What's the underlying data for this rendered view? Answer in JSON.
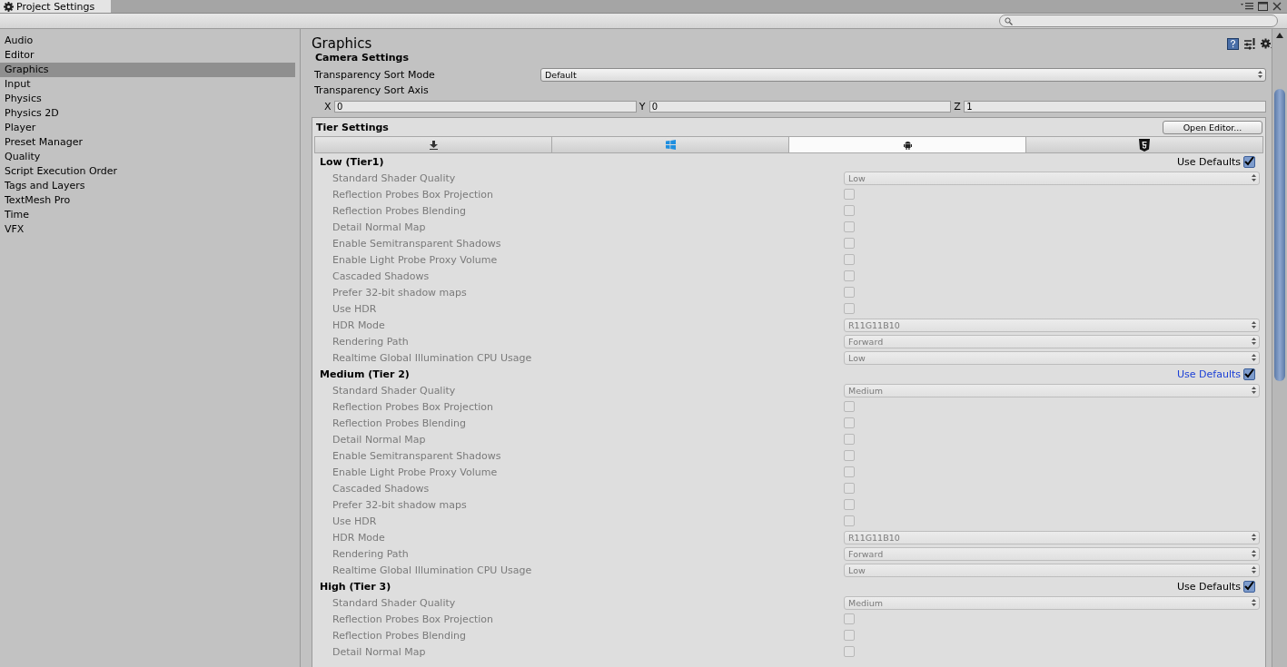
{
  "window": {
    "tab": "Project Settings"
  },
  "sidebar": {
    "items": [
      {
        "label": "Audio",
        "selected": false
      },
      {
        "label": "Editor",
        "selected": false
      },
      {
        "label": "Graphics",
        "selected": true
      },
      {
        "label": "Input",
        "selected": false
      },
      {
        "label": "Physics",
        "selected": false
      },
      {
        "label": "Physics 2D",
        "selected": false
      },
      {
        "label": "Player",
        "selected": false
      },
      {
        "label": "Preset Manager",
        "selected": false
      },
      {
        "label": "Quality",
        "selected": false
      },
      {
        "label": "Script Execution Order",
        "selected": false
      },
      {
        "label": "Tags and Layers",
        "selected": false
      },
      {
        "label": "TextMesh Pro",
        "selected": false
      },
      {
        "label": "Time",
        "selected": false
      },
      {
        "label": "VFX",
        "selected": false
      }
    ]
  },
  "page": {
    "title": "Graphics",
    "section": "Camera Settings",
    "sort_mode": {
      "label": "Transparency Sort Mode",
      "value": "Default"
    },
    "sort_axis": {
      "label": "Transparency Sort Axis",
      "fields": [
        {
          "axis": "X",
          "value": "0"
        },
        {
          "axis": "Y",
          "value": "0"
        },
        {
          "axis": "Z",
          "value": "1"
        }
      ]
    }
  },
  "tier_settings": {
    "title": "Tier Settings",
    "button": "Open Editor...",
    "platform_tabs": [
      {
        "kind": "standalone",
        "selected": false
      },
      {
        "kind": "windows",
        "selected": false
      },
      {
        "kind": "android",
        "selected": true
      },
      {
        "kind": "html5",
        "selected": false
      }
    ],
    "tiers": [
      {
        "name": "Low (Tier1)",
        "use_defaults_label": "Use Defaults",
        "use_defaults": true,
        "highlighted": false,
        "settings": [
          {
            "label": "Standard Shader Quality",
            "kind": "dropdown",
            "value": "Low"
          },
          {
            "label": "Reflection Probes Box Projection",
            "kind": "checkbox",
            "checked": false
          },
          {
            "label": "Reflection Probes Blending",
            "kind": "checkbox",
            "checked": false
          },
          {
            "label": "Detail Normal Map",
            "kind": "checkbox",
            "checked": false
          },
          {
            "label": "Enable Semitransparent Shadows",
            "kind": "checkbox",
            "checked": false
          },
          {
            "label": "Enable Light Probe Proxy Volume",
            "kind": "checkbox",
            "checked": false
          },
          {
            "label": "Cascaded Shadows",
            "kind": "checkbox",
            "checked": false
          },
          {
            "label": "Prefer 32-bit shadow maps",
            "kind": "checkbox",
            "checked": false
          },
          {
            "label": "Use HDR",
            "kind": "checkbox",
            "checked": false
          },
          {
            "label": "HDR Mode",
            "kind": "dropdown",
            "value": "R11G11B10"
          },
          {
            "label": "Rendering Path",
            "kind": "dropdown",
            "value": "Forward"
          },
          {
            "label": "Realtime Global Illumination CPU Usage",
            "kind": "dropdown",
            "value": "Low"
          }
        ]
      },
      {
        "name": "Medium (Tier 2)",
        "use_defaults_label": "Use Defaults",
        "use_defaults": true,
        "highlighted": true,
        "settings": [
          {
            "label": "Standard Shader Quality",
            "kind": "dropdown",
            "value": "Medium"
          },
          {
            "label": "Reflection Probes Box Projection",
            "kind": "checkbox",
            "checked": false
          },
          {
            "label": "Reflection Probes Blending",
            "kind": "checkbox",
            "checked": false
          },
          {
            "label": "Detail Normal Map",
            "kind": "checkbox",
            "checked": false
          },
          {
            "label": "Enable Semitransparent Shadows",
            "kind": "checkbox",
            "checked": false
          },
          {
            "label": "Enable Light Probe Proxy Volume",
            "kind": "checkbox",
            "checked": false
          },
          {
            "label": "Cascaded Shadows",
            "kind": "checkbox",
            "checked": false
          },
          {
            "label": "Prefer 32-bit shadow maps",
            "kind": "checkbox",
            "checked": false
          },
          {
            "label": "Use HDR",
            "kind": "checkbox",
            "checked": false
          },
          {
            "label": "HDR Mode",
            "kind": "dropdown",
            "value": "R11G11B10"
          },
          {
            "label": "Rendering Path",
            "kind": "dropdown",
            "value": "Forward"
          },
          {
            "label": "Realtime Global Illumination CPU Usage",
            "kind": "dropdown",
            "value": "Low"
          }
        ]
      },
      {
        "name": "High (Tier 3)",
        "use_defaults_label": "Use Defaults",
        "use_defaults": true,
        "highlighted": false,
        "settings": [
          {
            "label": "Standard Shader Quality",
            "kind": "dropdown",
            "value": "Medium"
          },
          {
            "label": "Reflection Probes Box Projection",
            "kind": "checkbox",
            "checked": false
          },
          {
            "label": "Reflection Probes Blending",
            "kind": "checkbox",
            "checked": false
          },
          {
            "label": "Detail Normal Map",
            "kind": "checkbox",
            "checked": false
          }
        ]
      }
    ]
  }
}
